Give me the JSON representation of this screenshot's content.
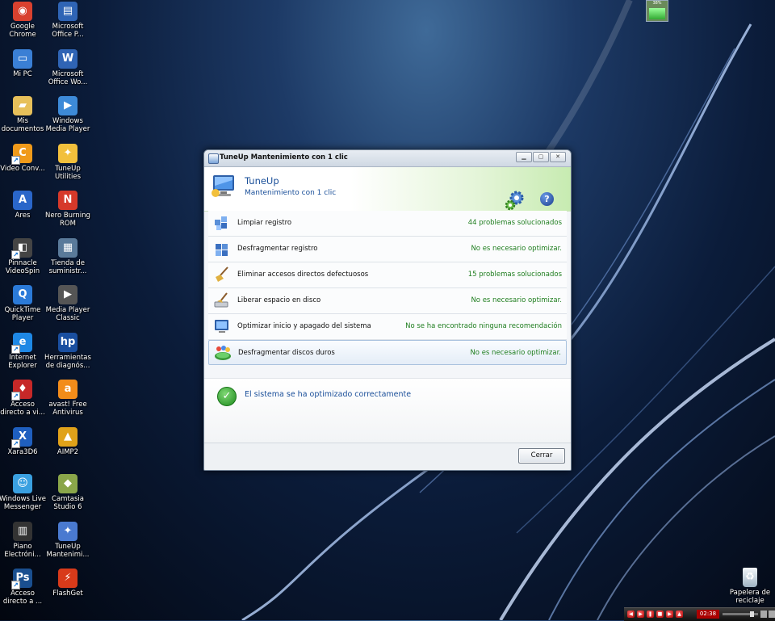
{
  "desktop": {
    "icons": [
      {
        "label": "Google Chrome",
        "glyph": "icon-chrome",
        "color": "#d9412f"
      },
      {
        "label": "Microsoft Office P...",
        "glyph": "icon-office-doc",
        "color": "#2f64b5"
      },
      {
        "label": "Mi PC",
        "glyph": "icon-computer",
        "color": "#3a7fd5"
      },
      {
        "label": "Microsoft Office Wo...",
        "glyph": "icon-word-doc",
        "color": "#2f64b5"
      },
      {
        "label": "Mis documentos",
        "glyph": "icon-folder",
        "color": "#e7c05a"
      },
      {
        "label": "Windows Media Player",
        "glyph": "icon-media-player",
        "color": "#3d8ad8"
      },
      {
        "label": "Video Conv...",
        "glyph": "icon-video-converter",
        "color": "#f09a1a"
      },
      {
        "label": "TuneUp Utilities",
        "glyph": "icon-tuneup",
        "color": "#f2c03c"
      },
      {
        "label": "Ares",
        "glyph": "icon-ares",
        "color": "#2a66c9"
      },
      {
        "label": "Nero Burning ROM",
        "glyph": "icon-nero",
        "color": "#d6392a"
      },
      {
        "label": "Pinnacle VideoSpin",
        "glyph": "icon-pinnacle",
        "color": "#444444"
      },
      {
        "label": "Tienda de suministr...",
        "glyph": "icon-store",
        "color": "#5a7a9a"
      },
      {
        "label": "QuickTime Player",
        "glyph": "icon-quicktime",
        "color": "#2b7ad8"
      },
      {
        "label": "Media Player Classic",
        "glyph": "icon-mpc",
        "color": "#555555"
      },
      {
        "label": "Internet Explorer",
        "glyph": "icon-ie",
        "color": "#1e88e5"
      },
      {
        "label": "Herramientas de diagnós...",
        "glyph": "icon-hp",
        "color": "#1a4fa0"
      },
      {
        "label": "Acceso directo a vi...",
        "glyph": "icon-shortcut-red",
        "color": "#c62828"
      },
      {
        "label": "avast! Free Antivirus",
        "glyph": "icon-avast",
        "color": "#f28c1a"
      },
      {
        "label": "Xara3D6",
        "glyph": "icon-xara",
        "color": "#1f5fbf"
      },
      {
        "label": "AIMP2",
        "glyph": "icon-aimp",
        "color": "#e0a21a"
      },
      {
        "label": "Windows Live Messenger",
        "glyph": "icon-messenger",
        "color": "#3aa0e0"
      },
      {
        "label": "Camtasia Studio 6",
        "glyph": "icon-camtasia",
        "color": "#8aa64a"
      },
      {
        "label": "Piano Electróni...",
        "glyph": "icon-piano",
        "color": "#333333"
      },
      {
        "label": "TuneUp Mantenimi...",
        "glyph": "icon-tuneup-maint",
        "color": "#4a7ad0"
      },
      {
        "label": "Acceso directo a ...",
        "glyph": "icon-photoshop",
        "color": "#1a4f8f"
      },
      {
        "label": "FlashGet",
        "glyph": "icon-flashget",
        "color": "#d83a1a"
      }
    ],
    "recycle_bin": {
      "label": "Papelera de reciclaje",
      "glyph": "icon-recycle-bin"
    },
    "tray_widget": {
      "percent": "38%"
    },
    "player": {
      "time": "02:38"
    }
  },
  "window": {
    "title": "TuneUp Mantenimiento con 1 clic",
    "header": {
      "app_name": "TuneUp",
      "subtitle": "Mantenimiento con 1 clic"
    },
    "tasks": [
      {
        "label": "Limpiar registro",
        "status": "44 problemas solucionados"
      },
      {
        "label": "Desfragmentar registro",
        "status": "No es necesario optimizar."
      },
      {
        "label": "Eliminar accesos directos defectuosos",
        "status": "15 problemas solucionados"
      },
      {
        "label": "Liberar espacio en disco",
        "status": "No es necesario optimizar."
      },
      {
        "label": "Optimizar inicio y apagado del sistema",
        "status": "No se ha encontrado ninguna recomendación"
      },
      {
        "label": "Desfragmentar discos duros",
        "status": "No es necesario optimizar."
      }
    ],
    "success_message": "El sistema se ha optimizado correctamente",
    "close_label": "Cerrar"
  }
}
